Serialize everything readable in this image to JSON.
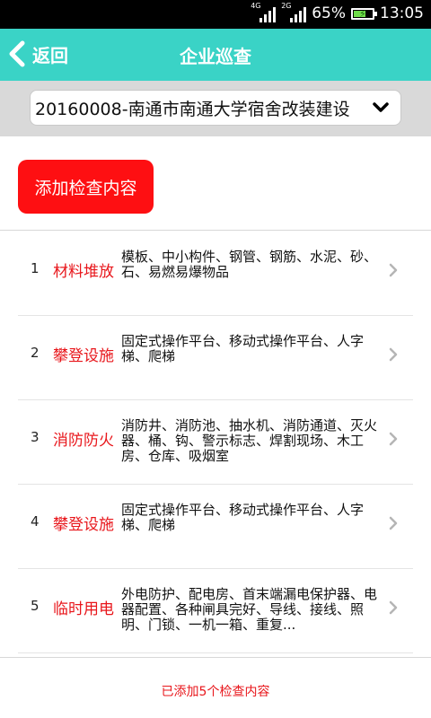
{
  "status_bar": {
    "network1": "4G",
    "network2": "2G",
    "battery_text": "65%",
    "battery_level": 0.65,
    "time": "13:05"
  },
  "header": {
    "back_label": "返回",
    "title": "企业巡查"
  },
  "project_select": {
    "value": "20160008-南通市南通大学宿舍改装建设"
  },
  "add_button": {
    "label": "添加检查内容"
  },
  "items": [
    {
      "num": "1",
      "category": "材料堆放",
      "desc": "模板、中小构件、钢管、钢筋、水泥、砂、石、易燃易爆物品"
    },
    {
      "num": "2",
      "category": "攀登设施",
      "desc": "固定式操作平台、移动式操作平台、人字梯、爬梯"
    },
    {
      "num": "3",
      "category": "消防防火",
      "desc": "消防井、消防池、抽水机、消防通道、灭火器、桶、钩、警示标志、焊割现场、木工房、仓库、吸烟室"
    },
    {
      "num": "4",
      "category": "攀登设施",
      "desc": "固定式操作平台、移动式操作平台、人字梯、爬梯"
    },
    {
      "num": "5",
      "category": "临时用电",
      "desc": "外电防护、配电房、首末端漏电保护器、电器配置、各种闸具完好、导线、接线、照明、门锁、一机一箱、重复..."
    }
  ],
  "footer": {
    "summary": "已添加5个检查内容"
  },
  "colors": {
    "header_bg": "#3ad3c6",
    "accent_red": "#fe0f12"
  }
}
